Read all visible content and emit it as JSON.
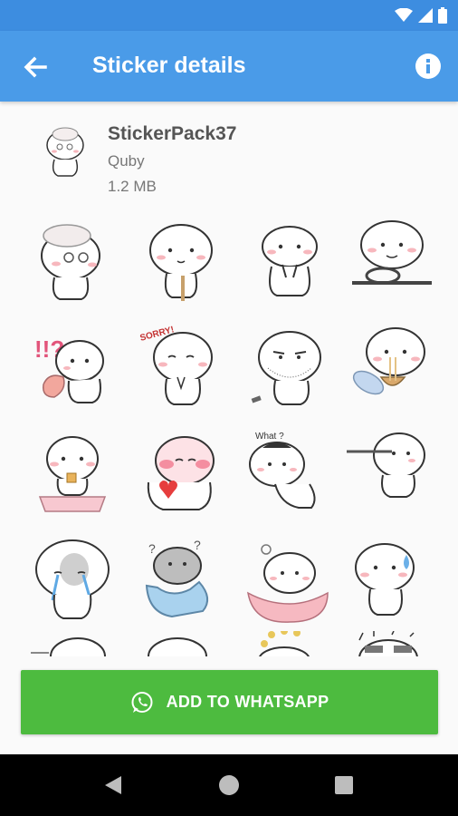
{
  "app_bar": {
    "title": "Sticker details",
    "back_icon": "arrow-left-icon",
    "info_icon": "info-icon",
    "color": "#4a9be8"
  },
  "status_bar": {
    "icons": [
      "wifi-icon",
      "signal-icon",
      "battery-icon"
    ],
    "color": "#3d8de0"
  },
  "pack": {
    "name": "StickerPack37",
    "publisher": "Quby",
    "size": "1.2 MB"
  },
  "stickers": {
    "rows": [
      [
        "granny-quby",
        "thinking-quby",
        "cheer-quby",
        "driving-quby"
      ],
      [
        "surprised-quby",
        "sorry-quby",
        "bearded-quby",
        "noodle-quby"
      ],
      [
        "scale-quby",
        "heart-quby",
        "what-quby",
        "long-nose-quby"
      ],
      [
        "crying-quby",
        "confused-quby",
        "pink-cushion-quby",
        "sweat-quby"
      ],
      [
        "partial-1",
        "partial-2",
        "partial-3",
        "partial-4"
      ]
    ],
    "labels": {
      "sorry": "SORRY!",
      "what": "What ?"
    }
  },
  "action": {
    "label": "ADD TO WHATSAPP",
    "icon": "whatsapp-icon",
    "color": "#4dbb3f"
  },
  "nav": {
    "icons": [
      "back-triangle-icon",
      "home-circle-icon",
      "recents-square-icon"
    ]
  }
}
